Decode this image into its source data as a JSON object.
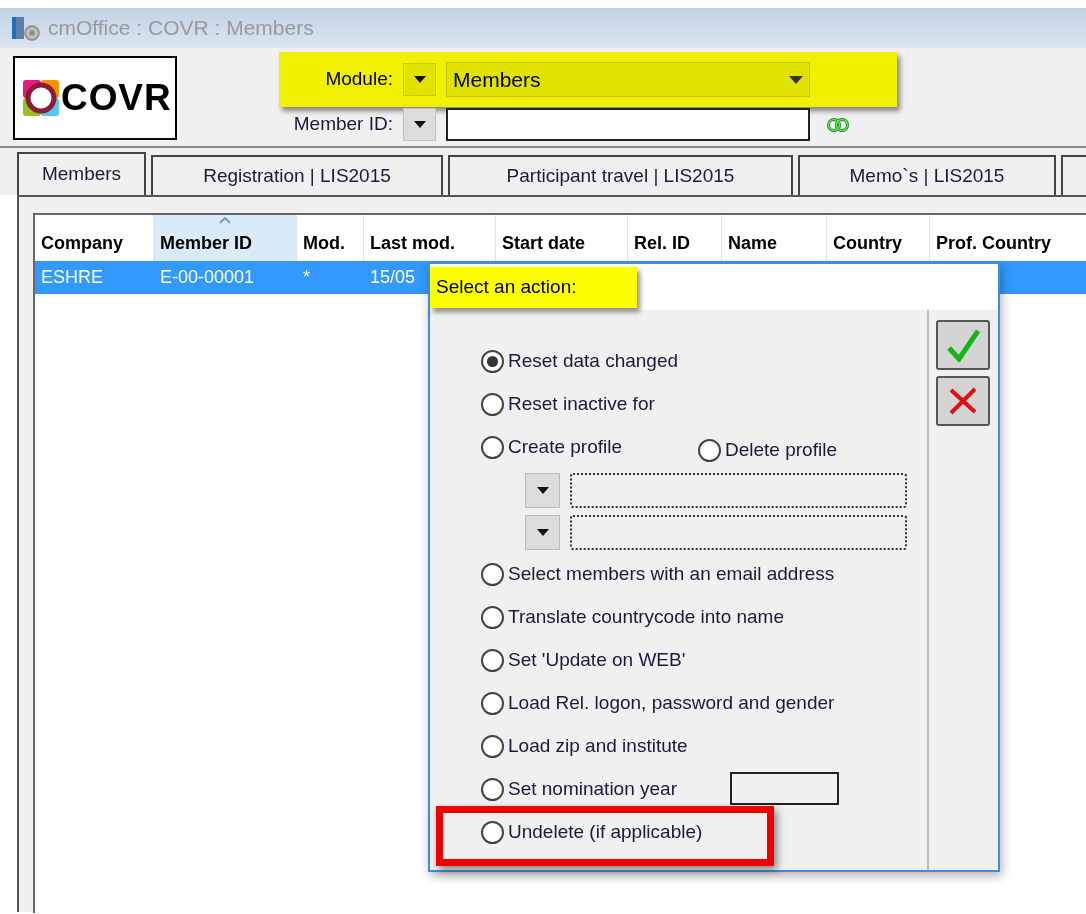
{
  "window": {
    "title": "cmOffice : COVR : Members"
  },
  "logo": {
    "text": "COVR"
  },
  "module": {
    "label": "Module:",
    "value": "Members"
  },
  "member_id": {
    "label": "Member ID:"
  },
  "tabs": [
    {
      "label": "Members",
      "selected": true
    },
    {
      "label": "Registration | LIS2015",
      "selected": false
    },
    {
      "label": "Participant travel | LIS2015",
      "selected": false
    },
    {
      "label": "Memo`s | LIS2015",
      "selected": false
    }
  ],
  "table": {
    "columns": [
      {
        "label": "Company",
        "sorted": false
      },
      {
        "label": "Member ID",
        "sorted": true
      },
      {
        "label": "Mod.",
        "sorted": false
      },
      {
        "label": "Last mod.",
        "sorted": false
      },
      {
        "label": "Start date",
        "sorted": false
      },
      {
        "label": "Rel. ID",
        "sorted": false
      },
      {
        "label": "Name",
        "sorted": false
      },
      {
        "label": "Country",
        "sorted": false
      },
      {
        "label": "Prof. Country",
        "sorted": false
      }
    ],
    "rows": [
      {
        "selected": true,
        "cells": [
          "ESHRE",
          "E-00-00001",
          "*",
          "15/05"
        ]
      }
    ]
  },
  "dialog": {
    "title": "Select an action:",
    "options": [
      {
        "kind": "radio",
        "label": "Reset data changed",
        "selected": true,
        "highlighted": false
      },
      {
        "kind": "radio",
        "label": "Reset inactive for",
        "selected": false,
        "highlighted": false
      },
      {
        "kind": "radio_pair",
        "choices": [
          {
            "label": "Create profile",
            "selected": false
          },
          {
            "label": "Delete profile",
            "selected": false
          }
        ]
      },
      {
        "kind": "dropdown"
      },
      {
        "kind": "dropdown"
      },
      {
        "kind": "radio",
        "label": "Select members with an email address",
        "selected": false,
        "highlighted": false
      },
      {
        "kind": "radio",
        "label": "Translate countrycode into name",
        "selected": false,
        "highlighted": false
      },
      {
        "kind": "radio",
        "label": "Set 'Update on WEB'",
        "selected": false,
        "highlighted": false
      },
      {
        "kind": "radio",
        "label": "Load Rel. logon, password and gender",
        "selected": false,
        "highlighted": false
      },
      {
        "kind": "radio",
        "label": "Load zip and institute",
        "selected": false,
        "highlighted": false
      },
      {
        "kind": "radio_field",
        "label": "Set nomination year",
        "selected": false,
        "highlighted": false
      },
      {
        "kind": "radio",
        "label": "Undelete (if applicable)",
        "selected": false,
        "highlighted": true
      }
    ],
    "buttons": [
      {
        "kind": "ok"
      },
      {
        "kind": "cancel"
      }
    ]
  }
}
